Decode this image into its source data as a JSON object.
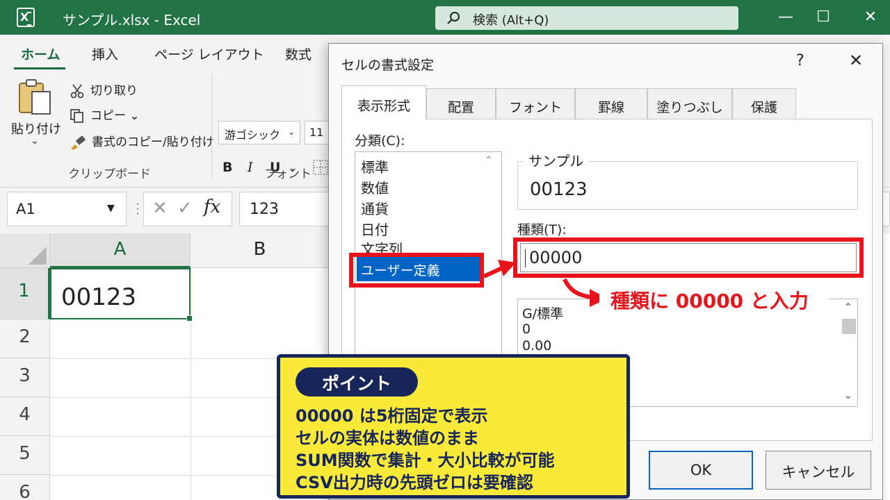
{
  "window": {
    "app_icon_letter": "X",
    "title": "サンプル.xlsx  -  Excel",
    "search_text": "検索 (Alt+Q)",
    "minimize": "—",
    "maximize": "☐",
    "close": "✕"
  },
  "ribbon": {
    "tabs": [
      "ホーム",
      "挿入",
      "ページ レイアウト",
      "数式"
    ],
    "clipboard": {
      "paste": "貼り付け",
      "paste_caret": "⌄",
      "cut": "切り取り",
      "copy": "コピー ⌄",
      "format_painter": "書式のコピー/貼り付け",
      "group": "クリップボード"
    },
    "font": {
      "name": "游ゴシック",
      "name_caret": "⌄",
      "size": "11",
      "bold": "B",
      "italic": "I",
      "underline": "U",
      "underline_caret": "⌄",
      "group": "フォント"
    }
  },
  "formula_bar": {
    "name_box": "A1",
    "name_caret": "▼",
    "dots": "⋮",
    "cancel": "✕",
    "enter": "✓",
    "fx": "fx",
    "value": "123"
  },
  "sheet": {
    "columns": [
      "A",
      "B"
    ],
    "rows": [
      "1",
      "2",
      "3",
      "4",
      "5",
      "6"
    ],
    "cell_A1": "00123"
  },
  "dialog": {
    "title": "セルの書式設定",
    "help": "?",
    "close": "✕",
    "tabs": [
      "表示形式",
      "配置",
      "フォント",
      "罫線",
      "塗りつぶし",
      "保護"
    ],
    "category_label": "分類(C):",
    "categories": [
      "標準",
      "数値",
      "通貨",
      "日付",
      "文字列"
    ],
    "selected_category": "ユーザー定義",
    "list_scroll_up": "⌃",
    "sample_label": "サンプル",
    "sample_value": "00123",
    "type_label": "種類(T):",
    "type_value": "00000",
    "type_list": [
      "G/標準",
      "0",
      "0.00"
    ],
    "type_list_up": "⌃",
    "type_list_down": "⌄",
    "ok": "OK",
    "cancel": "キャンセル"
  },
  "annotation": {
    "callout": "種類に 00000 と入力",
    "accent_color": "#e8141b"
  },
  "point": {
    "badge": "ポイント",
    "lines": [
      "00000 は5桁固定で表示",
      "セルの実体は数値のまま",
      "SUM関数で集計・大小比較が可能",
      "CSV出力時の先頭ゼロは要確認"
    ]
  }
}
